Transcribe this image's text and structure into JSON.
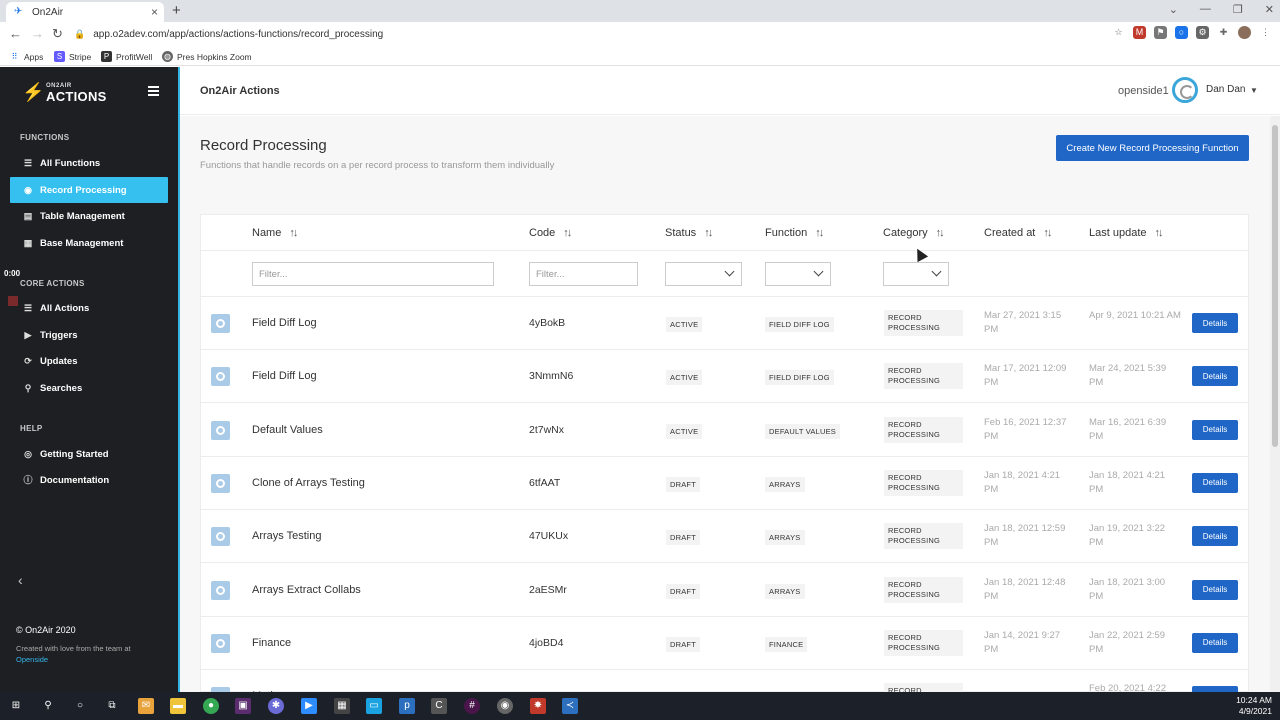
{
  "browser": {
    "tab_title": "On2Air",
    "url": "app.o2adev.com/app/actions/actions-functions/record_processing",
    "bookmarks": [
      {
        "label": "Apps",
        "icon": "apps-grid-icon",
        "color": "#1a73e8"
      },
      {
        "label": "Stripe",
        "icon": "stripe-icon",
        "color": "#635bff"
      },
      {
        "label": "ProfitWell",
        "icon": "profitwell-icon",
        "color": "#333333"
      },
      {
        "label": "Pres Hopkins Zoom",
        "icon": "globe-icon",
        "color": "#666666"
      }
    ]
  },
  "sidebar": {
    "logo_sub": "ON2AIR",
    "logo_main": "ACTIONS",
    "timer": "0:00",
    "sections": [
      {
        "title": "FUNCTIONS",
        "items": [
          {
            "label": "All Functions",
            "icon": "list-icon",
            "active": false
          },
          {
            "label": "Record Processing",
            "icon": "record-icon",
            "active": true
          },
          {
            "label": "Table Management",
            "icon": "table-icon",
            "active": false
          },
          {
            "label": "Base Management",
            "icon": "database-icon",
            "active": false
          }
        ]
      },
      {
        "title": "CORE ACTIONS",
        "items": [
          {
            "label": "All Actions",
            "icon": "list-icon",
            "active": false
          },
          {
            "label": "Triggers",
            "icon": "play-icon",
            "active": false
          },
          {
            "label": "Updates",
            "icon": "refresh-icon",
            "active": false
          },
          {
            "label": "Searches",
            "icon": "search-icon",
            "active": false
          }
        ]
      },
      {
        "title": "HELP",
        "items": [
          {
            "label": "Getting Started",
            "icon": "target-icon",
            "active": false
          },
          {
            "label": "Documentation",
            "icon": "info-icon",
            "active": false
          }
        ]
      }
    ],
    "footer_copyright": "© On2Air 2020",
    "footer_love": "Created with love from the team at",
    "footer_link": "Openside"
  },
  "topbar": {
    "title": "On2Air Actions",
    "account": "openside1",
    "user": "Dan Dan"
  },
  "page": {
    "title": "Record Processing",
    "subtitle": "Functions that handle records on a per record process to transform them individually",
    "create_button": "Create New Record Processing Function"
  },
  "table": {
    "columns": [
      "Name",
      "Code",
      "Status",
      "Function",
      "Category",
      "Created at",
      "Last update"
    ],
    "filter_placeholder": "Filter...",
    "details_label": "Details",
    "rows": [
      {
        "name": "Field Diff Log",
        "code": "4yBokB",
        "status": "ACTIVE",
        "function": "FIELD DIFF LOG",
        "category": "RECORD PROCESSING",
        "created": "Mar 27, 2021 3:15 PM",
        "updated": "Apr 9, 2021 10:21 AM"
      },
      {
        "name": "Field Diff Log",
        "code": "3NmmN6",
        "status": "ACTIVE",
        "function": "FIELD DIFF LOG",
        "category": "RECORD PROCESSING",
        "created": "Mar 17, 2021 12:09 PM",
        "updated": "Mar 24, 2021 5:39 PM"
      },
      {
        "name": "Default Values",
        "code": "2t7wNx",
        "status": "ACTIVE",
        "function": "DEFAULT VALUES",
        "category": "RECORD PROCESSING",
        "created": "Feb 16, 2021 12:37 PM",
        "updated": "Mar 16, 2021 6:39 PM"
      },
      {
        "name": "Clone of Arrays Testing",
        "code": "6tfAAT",
        "status": "DRAFT",
        "function": "ARRAYS",
        "category": "RECORD PROCESSING",
        "created": "Jan 18, 2021 4:21 PM",
        "updated": "Jan 18, 2021 4:21 PM"
      },
      {
        "name": "Arrays Testing",
        "code": "47UKUx",
        "status": "DRAFT",
        "function": "ARRAYS",
        "category": "RECORD PROCESSING",
        "created": "Jan 18, 2021 12:59 PM",
        "updated": "Jan 19, 2021 3:22 PM"
      },
      {
        "name": "Arrays Extract Collabs",
        "code": "2aESMr",
        "status": "DRAFT",
        "function": "ARRAYS",
        "category": "RECORD PROCESSING",
        "created": "Jan 18, 2021 12:48 PM",
        "updated": "Jan 18, 2021 3:00 PM"
      },
      {
        "name": "Finance",
        "code": "4joBD4",
        "status": "DRAFT",
        "function": "FINANCE",
        "category": "RECORD PROCESSING",
        "created": "Jan 14, 2021 9:27 PM",
        "updated": "Jan 22, 2021 2:59 PM"
      },
      {
        "name": "Math",
        "code": "",
        "status": "",
        "function": "",
        "category": "RECORD PROCESSING",
        "created": "",
        "updated": "Feb 20, 2021 4:22"
      }
    ]
  },
  "taskbar": {
    "time": "10:24 AM",
    "date": "4/9/2021"
  }
}
